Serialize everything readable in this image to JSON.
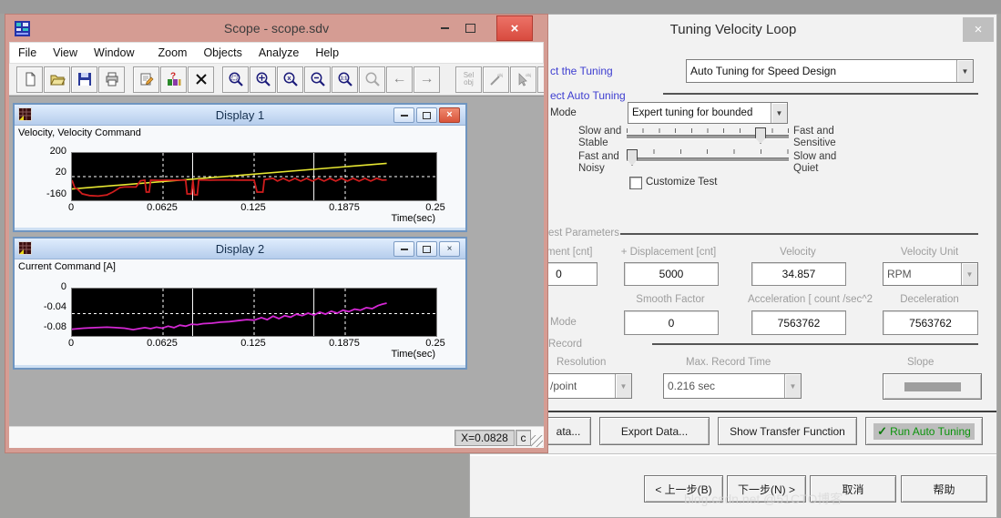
{
  "scope": {
    "title": "Scope - scope.sdv",
    "menu": [
      "File",
      "View",
      "Window",
      "Zoom",
      "Objects",
      "Analyze",
      "Help"
    ],
    "toolbar": {
      "sel_line1": "Sel",
      "sel_line2": "obj",
      "obj_tag": "obj",
      "zoom_x_glyph": "x",
      "zoom_11_glyph": "1:1",
      "arrow_left": "←",
      "arrow_right": "→"
    },
    "controls": {
      "close": "×"
    },
    "status": {
      "x_readout": "X=0.0828",
      "unit_box": "c"
    }
  },
  "displays": {
    "controls": {
      "close": "×"
    }
  },
  "dialog": {
    "title": "Tuning Velocity Loop",
    "close": "×",
    "select_tuning_label": "ct the  Tuning",
    "tuning_method_value": "Auto Tuning for Speed Design",
    "select_auto_label": "ect Auto Tuning",
    "mode_label": "Mode",
    "mode_value": "Expert tuning for bounded",
    "slider_speed": {
      "left1": "Slow and",
      "left2": "Stable",
      "right1": "Fast and",
      "right2": "Sensitive"
    },
    "slider_noise": {
      "left1": "Fast and",
      "left2": "Noisy",
      "right1": "Slow and",
      "right2": "Quiet"
    },
    "customize_test_label": "Customize Test",
    "test_parameters": {
      "group_label": "est  Parameters",
      "disp_minus_label": "ment [cnt]",
      "disp_minus_value": "0",
      "disp_plus_label": "+ Displacement [cnt]",
      "disp_plus_value": "5000",
      "velocity_label": "Velocity",
      "velocity_value": "34.857",
      "velocity_unit_label": "Velocity Unit",
      "velocity_unit_value": "RPM",
      "smooth_label": "Smooth Factor",
      "smooth_value": "0",
      "accel_label": "Acceleration   [ count /sec^2",
      "accel_value": "7563762",
      "decel_label": "Deceleration",
      "decel_value": "7563762",
      "mode_label": "Mode"
    },
    "record": {
      "label": "Record",
      "resolution_label": "Resolution",
      "resolution_value": "/point",
      "max_record_label": "Max. Record Time",
      "max_record_value": "0.216 sec",
      "slope_label": "Slope"
    },
    "actions": {
      "save_data": "ata...",
      "export_data": "Export Data...",
      "show_transfer": "Show Transfer Function",
      "run_auto_tuning": "Run Auto Tuning",
      "run_check": "✓"
    },
    "wizard": {
      "back": "< 上一步(B)",
      "next": "下一步(N) >",
      "cancel": "取消",
      "help": "帮助"
    }
  },
  "watermark": "blog.csdn.net  @51CTO博客",
  "chart_data": [
    {
      "type": "line",
      "title": "Display 1",
      "signal_label": "Velocity, Velocity Command",
      "xlabel": "Time(sec)",
      "xlim": [
        0,
        0.25
      ],
      "ylim": [
        -200,
        200
      ],
      "xticks": [
        {
          "v": 0,
          "label": "0"
        },
        {
          "v": 0.0625,
          "label": "0.0625"
        },
        {
          "v": 0.125,
          "label": "0.125"
        },
        {
          "v": 0.1875,
          "label": "0.1875"
        },
        {
          "v": 0.25,
          "label": "0.25"
        }
      ],
      "yticks": [
        {
          "v": 200,
          "label": "200"
        },
        {
          "v": 20,
          "label": "20"
        },
        {
          "v": -160,
          "label": "-160"
        }
      ],
      "grid": {
        "v_dashed": [
          0.0625,
          0.125,
          0.1875
        ],
        "v_solid": [
          0.0828,
          0.166
        ],
        "h_dashed": [
          0
        ]
      },
      "series": [
        {
          "name": "Velocity Command",
          "color": "#e6e632",
          "width": 1.6,
          "points": [
            [
              0,
              -105
            ],
            [
              0.216,
              112
            ]
          ]
        },
        {
          "name": "Velocity",
          "color": "#cf1d1d",
          "width": 1.8,
          "points": [
            [
              0,
              -30
            ],
            [
              0.002,
              -95
            ],
            [
              0.004,
              -108
            ],
            [
              0.007,
              -145
            ],
            [
              0.012,
              -160
            ],
            [
              0.018,
              -165
            ],
            [
              0.024,
              -155
            ],
            [
              0.028,
              -131
            ],
            [
              0.033,
              -92
            ],
            [
              0.036,
              -88
            ],
            [
              0.044,
              -88
            ],
            [
              0.047,
              -35
            ],
            [
              0.05,
              -30
            ],
            [
              0.051,
              -131
            ],
            [
              0.053,
              -131
            ],
            [
              0.054,
              -30
            ],
            [
              0.06,
              -32
            ],
            [
              0.065,
              -30
            ],
            [
              0.078,
              -30
            ],
            [
              0.079,
              -146
            ],
            [
              0.082,
              -146
            ],
            [
              0.083,
              -30
            ],
            [
              0.084,
              -154
            ],
            [
              0.086,
              -154
            ],
            [
              0.087,
              -28
            ],
            [
              0.095,
              -30
            ],
            [
              0.105,
              -28
            ],
            [
              0.115,
              -30
            ],
            [
              0.125,
              -30
            ],
            [
              0.127,
              -131
            ],
            [
              0.131,
              -131
            ],
            [
              0.132,
              -25
            ],
            [
              0.138,
              -15
            ],
            [
              0.141,
              -38
            ],
            [
              0.145,
              -15
            ],
            [
              0.149,
              -38
            ],
            [
              0.153,
              -15
            ],
            [
              0.157,
              -38
            ],
            [
              0.161,
              -15
            ],
            [
              0.165,
              -38
            ],
            [
              0.169,
              -15
            ],
            [
              0.173,
              -38
            ],
            [
              0.177,
              -15
            ],
            [
              0.181,
              -38
            ],
            [
              0.185,
              -15
            ],
            [
              0.189,
              -38
            ],
            [
              0.193,
              -15
            ],
            [
              0.197,
              -38
            ],
            [
              0.201,
              -15
            ],
            [
              0.205,
              -38
            ],
            [
              0.209,
              -15
            ],
            [
              0.213,
              -30
            ],
            [
              0.216,
              -28
            ]
          ]
        }
      ]
    },
    {
      "type": "line",
      "title": "Display 2",
      "signal_label": "Current Command [A]",
      "xlabel": "Time(sec)",
      "xlim": [
        0,
        0.25
      ],
      "ylim": [
        -0.0945,
        0
      ],
      "xticks": [
        {
          "v": 0,
          "label": "0"
        },
        {
          "v": 0.0625,
          "label": "0.0625"
        },
        {
          "v": 0.125,
          "label": "0.125"
        },
        {
          "v": 0.1875,
          "label": "0.1875"
        },
        {
          "v": 0.25,
          "label": "0.25"
        }
      ],
      "yticks": [
        {
          "v": 0,
          "label": "0"
        },
        {
          "v": -0.04,
          "label": "-0.04"
        },
        {
          "v": -0.08,
          "label": "-0.08"
        }
      ],
      "grid": {
        "v_dashed": [
          0.0625,
          0.125,
          0.1875
        ],
        "v_solid": [
          0.0828,
          0.166
        ],
        "h_dashed": [
          -0.05
        ]
      },
      "series": [
        {
          "name": "Current Command",
          "color": "#d428d4",
          "width": 1.8,
          "points": [
            [
              0,
              -0.081
            ],
            [
              0.008,
              -0.079
            ],
            [
              0.016,
              -0.078
            ],
            [
              0.024,
              -0.077
            ],
            [
              0.03,
              -0.078
            ],
            [
              0.036,
              -0.079
            ],
            [
              0.042,
              -0.082
            ],
            [
              0.046,
              -0.08
            ],
            [
              0.05,
              -0.078
            ],
            [
              0.054,
              -0.08
            ],
            [
              0.058,
              -0.077
            ],
            [
              0.062,
              -0.079
            ],
            [
              0.066,
              -0.075
            ],
            [
              0.07,
              -0.078
            ],
            [
              0.074,
              -0.073
            ],
            [
              0.078,
              -0.075
            ],
            [
              0.082,
              -0.071
            ],
            [
              0.086,
              -0.072
            ],
            [
              0.09,
              -0.07
            ],
            [
              0.096,
              -0.069
            ],
            [
              0.102,
              -0.067
            ],
            [
              0.108,
              -0.066
            ],
            [
              0.114,
              -0.064
            ],
            [
              0.12,
              -0.062
            ],
            [
              0.125,
              -0.063
            ],
            [
              0.13,
              -0.058
            ],
            [
              0.134,
              -0.062
            ],
            [
              0.138,
              -0.055
            ],
            [
              0.142,
              -0.06
            ],
            [
              0.146,
              -0.054
            ],
            [
              0.15,
              -0.057
            ],
            [
              0.154,
              -0.051
            ],
            [
              0.158,
              -0.054
            ],
            [
              0.162,
              -0.049
            ],
            [
              0.166,
              -0.053
            ],
            [
              0.17,
              -0.047
            ],
            [
              0.174,
              -0.051
            ],
            [
              0.178,
              -0.045
            ],
            [
              0.182,
              -0.049
            ],
            [
              0.186,
              -0.043
            ],
            [
              0.19,
              -0.046
            ],
            [
              0.194,
              -0.041
            ],
            [
              0.198,
              -0.043
            ],
            [
              0.202,
              -0.038
            ],
            [
              0.206,
              -0.04
            ],
            [
              0.21,
              -0.034
            ],
            [
              0.213,
              -0.031
            ],
            [
              0.216,
              -0.029
            ]
          ]
        }
      ]
    }
  ]
}
